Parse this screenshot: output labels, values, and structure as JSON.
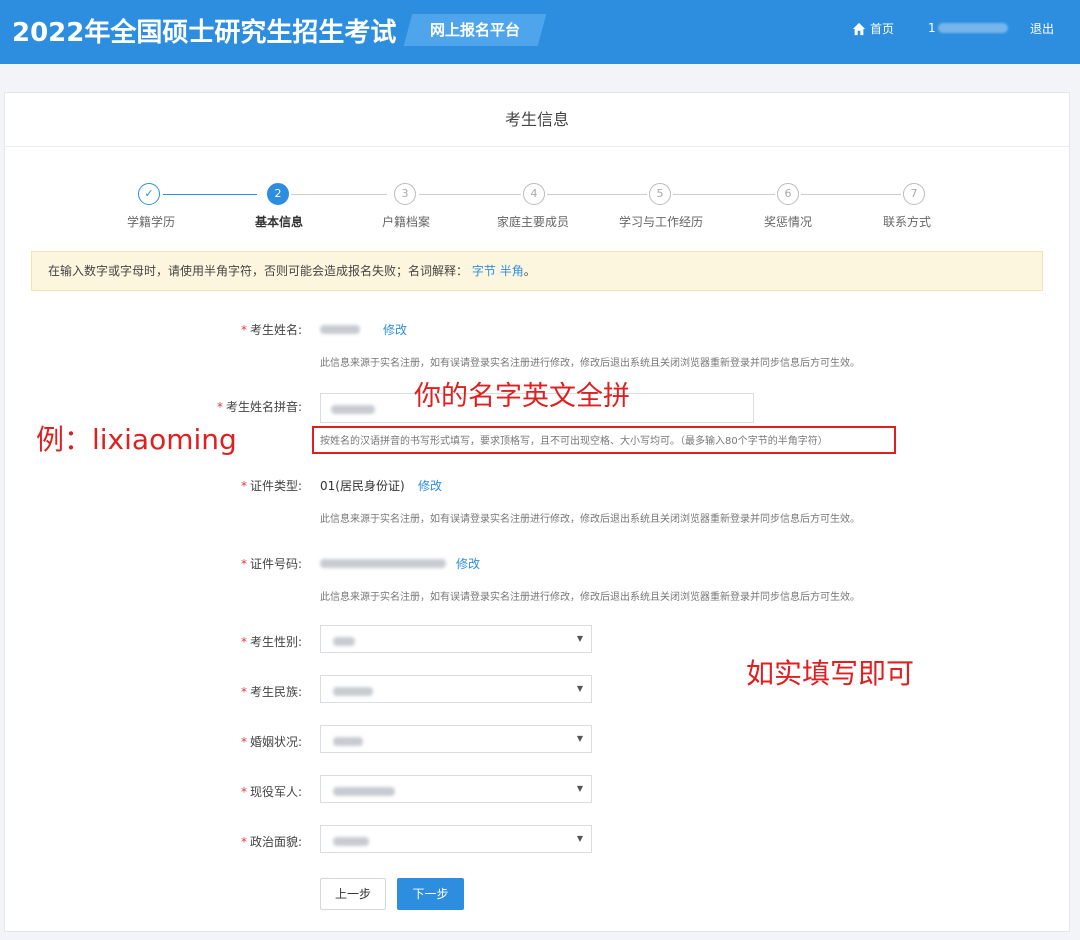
{
  "header": {
    "title": "2022年全国硕士研究生招生考试",
    "platform": "网上报名平台",
    "home": "首页",
    "user_prefix": "1",
    "logout": "退出"
  },
  "card": {
    "title": "考生信息"
  },
  "steps": [
    {
      "num": "✓",
      "label": "学籍学历",
      "state": "done"
    },
    {
      "num": "2",
      "label": "基本信息",
      "state": "active"
    },
    {
      "num": "3",
      "label": "户籍档案",
      "state": "todo"
    },
    {
      "num": "4",
      "label": "家庭主要成员",
      "state": "todo"
    },
    {
      "num": "5",
      "label": "学习与工作经历",
      "state": "todo"
    },
    {
      "num": "6",
      "label": "奖惩情况",
      "state": "todo"
    },
    {
      "num": "7",
      "label": "联系方式",
      "state": "todo"
    }
  ],
  "notice": {
    "text": "在输入数字或字母时，请使用半角字符，否则可能会造成报名失败；名词解释：",
    "link1": "字节",
    "link2": "半角",
    "end": "。"
  },
  "form": {
    "required_mark": "*",
    "name": {
      "label": "考生姓名:",
      "edit": "修改",
      "help": "此信息来源于实名注册，如有误请登录实名注册进行修改，修改后退出系统且关闭浏览器重新登录并同步信息后方可生效。"
    },
    "pinyin": {
      "label": "考生姓名拼音:",
      "help": "按姓名的汉语拼音的书写形式填写，要求顶格写，且不可出现空格、大小写均可。（最多输入80个字节的半角字符）"
    },
    "id_type": {
      "label": "证件类型:",
      "value": "01(居民身份证)",
      "edit": "修改",
      "help": "此信息来源于实名注册，如有误请登录实名注册进行修改，修改后退出系统且关闭浏览器重新登录并同步信息后方可生效。"
    },
    "id_number": {
      "label": "证件号码:",
      "edit": "修改",
      "help": "此信息来源于实名注册，如有误请登录实名注册进行修改，修改后退出系统且关闭浏览器重新登录并同步信息后方可生效。"
    },
    "gender": {
      "label": "考生性别:"
    },
    "ethnicity": {
      "label": "考生民族:"
    },
    "marital": {
      "label": "婚姻状况:"
    },
    "military": {
      "label": "现役军人:"
    },
    "political": {
      "label": "政治面貌:"
    }
  },
  "annotations": {
    "pinyin_hint": "你的名字英文全拼",
    "example": "例：lixiaoming",
    "fill_hint": "如实填写即可",
    "color": "#e02020"
  },
  "buttons": {
    "prev": "上一步",
    "next": "下一步"
  },
  "colors": {
    "primary": "#2d8ee0",
    "required": "#e4393c",
    "notice_bg": "#fdf6df"
  }
}
